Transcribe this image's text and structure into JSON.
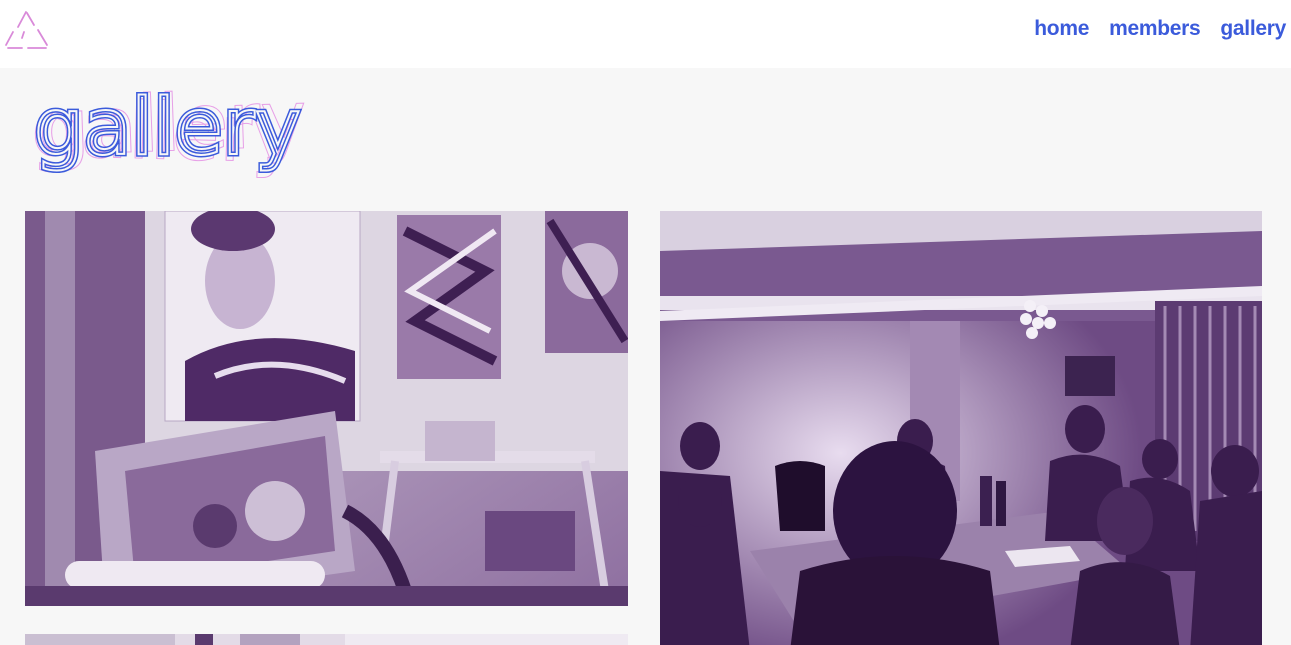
{
  "logo": {
    "icon": "triangle-logo-icon",
    "color": "#d98ad9"
  },
  "nav": {
    "items": [
      {
        "label": "home"
      },
      {
        "label": "members"
      },
      {
        "label": "gallery"
      }
    ],
    "color": "#3b5bdb"
  },
  "page": {
    "heading": "gallery",
    "heading_color": "#3b5bdb",
    "heading_glow_color": "#e7a0e7"
  },
  "gallery": {
    "tint_dark": "#4a2a5e",
    "tint_light": "#e8e2ec",
    "images": [
      {
        "subject": "studio-paintings"
      },
      {
        "subject": "group-dinner"
      },
      {
        "subject": "partial-photo"
      }
    ]
  }
}
